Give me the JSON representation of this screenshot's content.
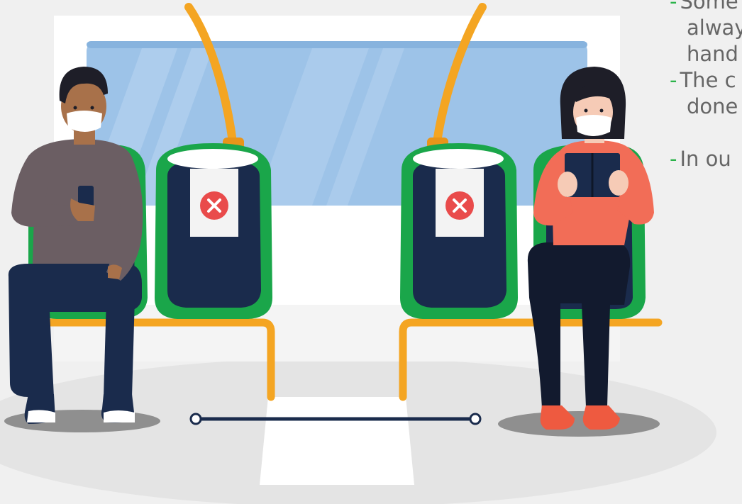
{
  "colors": {
    "background": "#f0f0f0",
    "window_glass": "#9dc3e8",
    "seat_green": "#1aa64a",
    "seat_navy": "#1a2b4c",
    "rail_orange": "#f4a522",
    "blocked_red": "#e94b4b",
    "shadow_grey": "#8f8f8f",
    "bullet_green": "#2bb34a",
    "note_text": "#666666"
  },
  "illustration": {
    "icons": [
      "cross-icon",
      "cross-icon"
    ],
    "people": [
      "man-with-mask-using-phone",
      "woman-with-mask-reading-book"
    ]
  },
  "notes": [
    {
      "dash": "-",
      "lines": [
        "Some",
        "alway",
        "hand"
      ]
    },
    {
      "dash": "-",
      "lines": [
        "The c",
        "done"
      ]
    },
    {
      "dash": "-",
      "lines": [
        "In ou"
      ]
    }
  ]
}
